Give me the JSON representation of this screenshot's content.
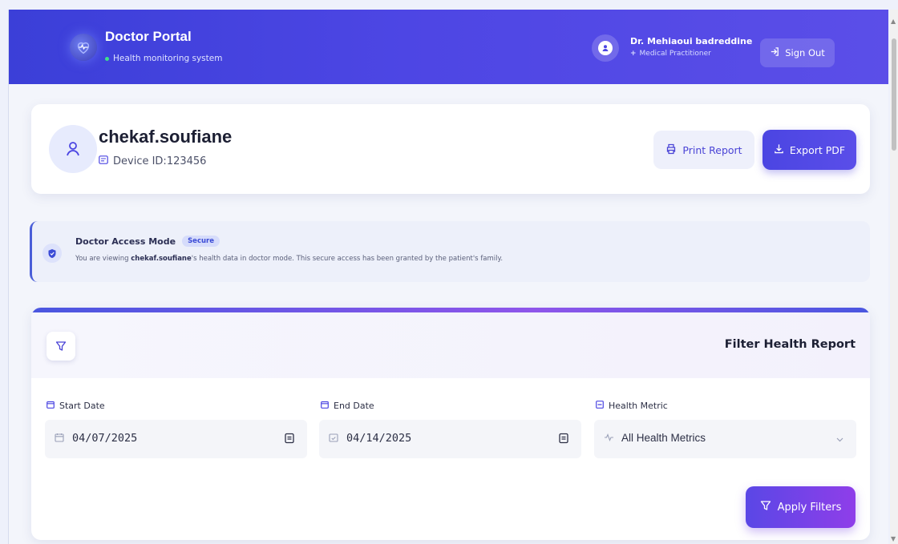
{
  "header": {
    "brand_title": "Doctor Portal",
    "brand_subtitle": "Health monitoring system",
    "doctor_name": "Dr. Mehiaoui badreddine",
    "doctor_role": "Medical Practitioner",
    "sign_out_label": "Sign Out",
    "gradient_colors": [
      "#3b3fd8",
      "#5b4ee8"
    ]
  },
  "patient": {
    "name": "chekaf.soufiane",
    "device_id": "Device ID:123456",
    "print_label": "Print Report",
    "export_label": "Export PDF"
  },
  "access": {
    "title": "Doctor Access Mode",
    "badge": "Secure",
    "text_prefix": "You are viewing ",
    "patient_bold": "chekaf.soufiane",
    "text_suffix": "'s health data in doctor mode. This secure access has been granted by the patient's family."
  },
  "filter": {
    "title": "Filter Health Report",
    "start_label": "Start Date",
    "start_value": "04/07/2025",
    "end_label": "End Date",
    "end_value": "04/14/2025",
    "metric_label": "Health Metric",
    "metric_value": "All Health Metrics",
    "apply_label": "Apply Filters"
  },
  "icons": [
    "heart-logo-icon",
    "user-circle-icon",
    "sign-out-icon",
    "user-icon",
    "id-card-icon",
    "printer-icon",
    "download-icon",
    "shield-icon",
    "filter-icon",
    "calendar-icon",
    "activity-icon",
    "chevron-down-icon"
  ],
  "accent_color": "#4b45e2"
}
